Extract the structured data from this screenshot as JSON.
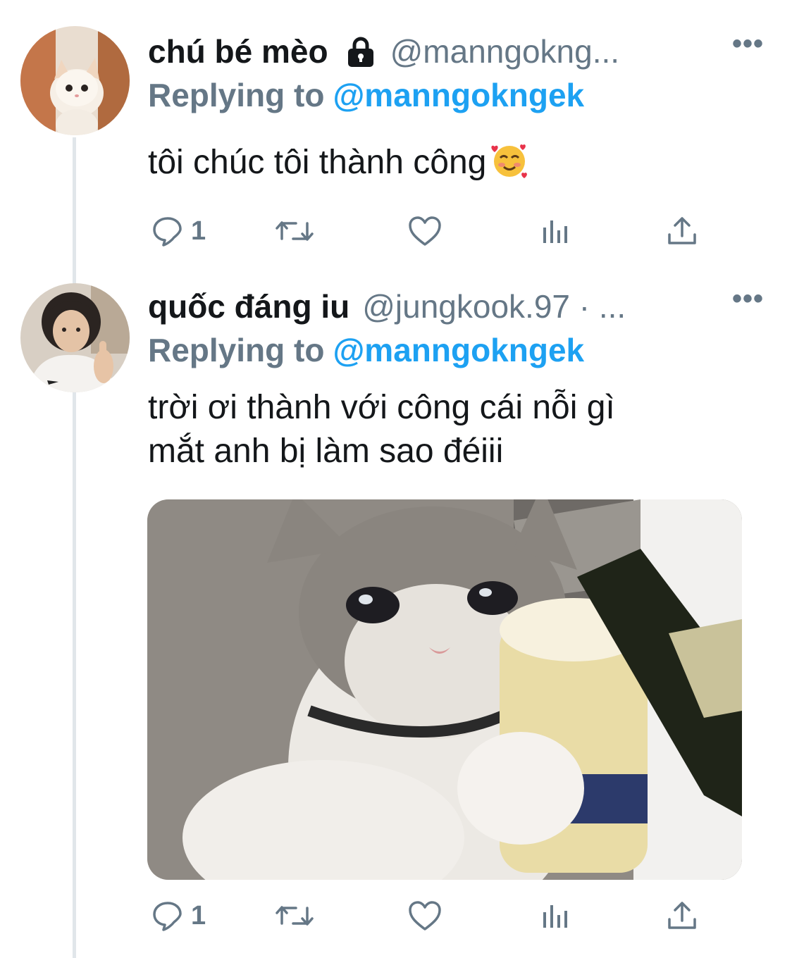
{
  "tweets": [
    {
      "display_name": "chú bé mèo",
      "locked": true,
      "handle": "@manngokng...",
      "reply_prefix": "Replying to",
      "reply_handle": "@manngokngek",
      "text": "tôi chúc tôi thành công",
      "emoji": "smiling-face-with-hearts-emoji",
      "actions": {
        "reply_count": "1"
      }
    },
    {
      "display_name": "quốc đáng iu",
      "handle": "@jungkook.97 · ...",
      "reply_prefix": "Replying to",
      "reply_handle": "@manngokngek",
      "text_line1": "trời ơi thành với công cái nỗi gì",
      "text_line2": "mắt anh bị làm sao đéiii",
      "media": "crying-cat-with-beer-image",
      "actions": {
        "reply_count": "1"
      }
    }
  ],
  "more_icon": "•••",
  "colors": {
    "link": "#1da1f2",
    "secondary": "#657786",
    "thread_line": "#e1e6ea"
  }
}
